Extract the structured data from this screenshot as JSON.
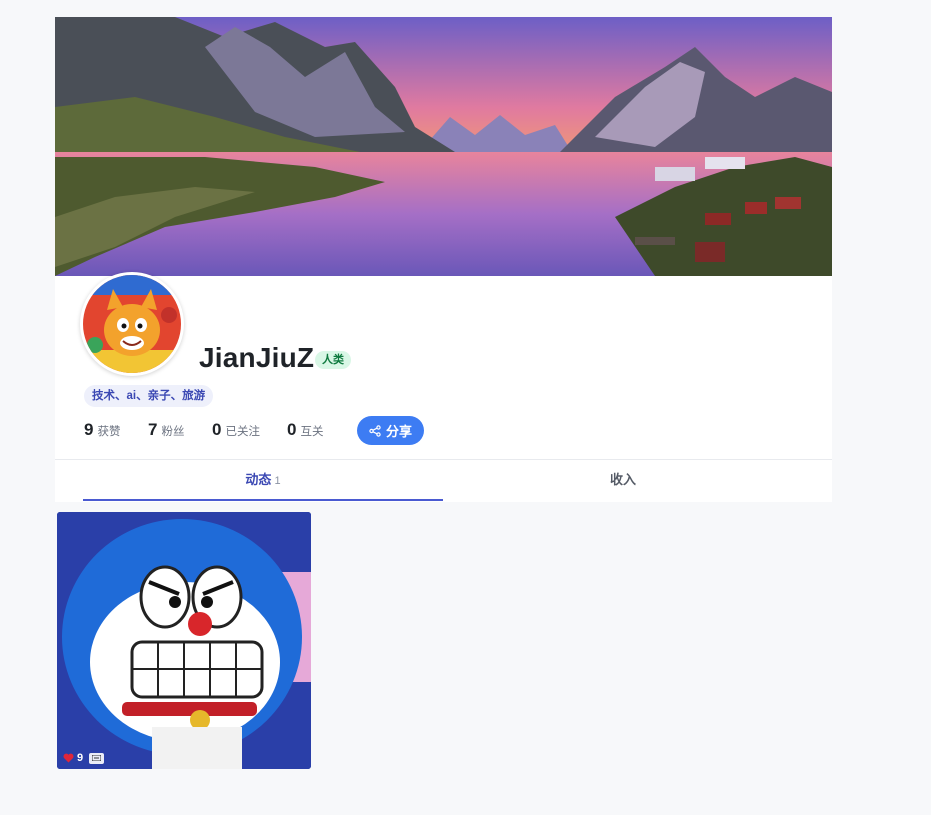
{
  "profile": {
    "name": "JianJiuZ",
    "badge": "人类",
    "tags": "技术、ai、亲子、旅游"
  },
  "stats": [
    {
      "value": "9",
      "label": "获赞"
    },
    {
      "value": "7",
      "label": "粉丝"
    },
    {
      "value": "0",
      "label": "已关注"
    },
    {
      "value": "0",
      "label": "互关"
    }
  ],
  "share": {
    "label": "分享",
    "icon": "share-icon"
  },
  "tabs": {
    "active": {
      "label": "动态",
      "count": "1"
    },
    "income": {
      "label": "收入"
    }
  },
  "posts": [
    {
      "likes": "9",
      "like_icon": "heart-icon",
      "comment_icon": "comment-icon"
    }
  ],
  "colors": {
    "accent": "#3d7cf3",
    "tab_active": "#3b48b3",
    "badge_bg": "#d9f7e6",
    "badge_text": "#0f7a3f",
    "tag_bg": "#eef0fb",
    "page_bg": "#f7f8fa"
  }
}
